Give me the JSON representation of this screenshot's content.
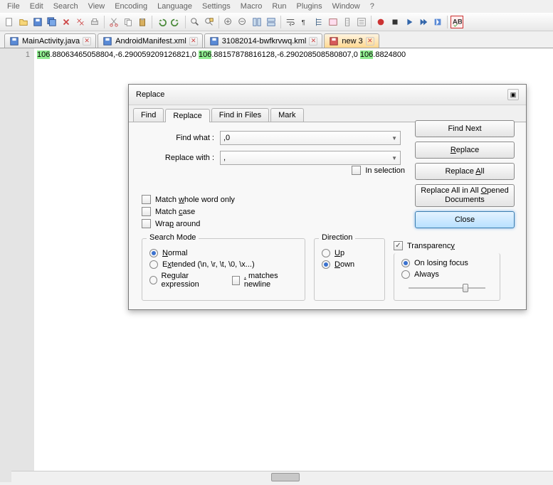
{
  "menu": {
    "items": [
      "File",
      "Edit",
      "Search",
      "View",
      "Encoding",
      "Language",
      "Settings",
      "Macro",
      "Run",
      "Plugins",
      "Window",
      "?"
    ]
  },
  "tabs": [
    {
      "name": "MainActivity.java",
      "icon": "blue"
    },
    {
      "name": "AndroidManifest.xml",
      "icon": "blue"
    },
    {
      "name": "31082014-bwfkrvwq.kml",
      "icon": "blue"
    },
    {
      "name": "new  3",
      "icon": "red",
      "active": true
    }
  ],
  "editor": {
    "line_no": "1",
    "segs": [
      "106",
      ".88063465058804,-6.290059209126821,0 ",
      "106",
      ".88157878816128,-6.290208508580807,0 ",
      "106",
      ".8824800"
    ]
  },
  "dialog": {
    "title": "Replace",
    "tabs": [
      "Find",
      "Replace",
      "Find in Files",
      "Mark"
    ],
    "active_tab": 1,
    "find_label": "Find what :",
    "find_value": ",0",
    "replace_label": "Replace with :",
    "replace_value": ",",
    "in_selection": "In selection",
    "buttons": {
      "find_next": "Find Next",
      "replace": "Replace",
      "replace_all": "Replace All",
      "replace_all_open": "Replace All in All Opened Documents",
      "close": "Close"
    },
    "opts": {
      "whole_word": "Match whole word only",
      "match_case": "Match case",
      "wrap": "Wrap around"
    },
    "search_mode": {
      "label": "Search Mode",
      "normal": "Normal",
      "extended": "Extended (\\n, \\r, \\t, \\0, \\x...)",
      "regex": "Regular expression",
      "dot_nl": ". matches newline"
    },
    "direction": {
      "label": "Direction",
      "up": "Up",
      "down": "Down"
    },
    "transparency": {
      "label": "Transparency",
      "on_lose": "On losing focus",
      "always": "Always"
    }
  }
}
